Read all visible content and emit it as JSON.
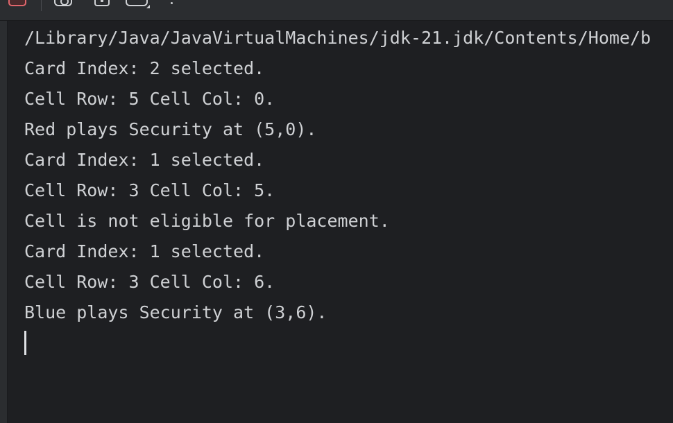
{
  "toolbar": {
    "icons": [
      "stop-icon",
      "screenshot-icon",
      "pin-icon",
      "restore-layout-icon",
      "more-icon"
    ],
    "colors": {
      "stop": "#e0666c",
      "icon": "#cfd1d4"
    }
  },
  "console": {
    "lines": [
      "/Library/Java/JavaVirtualMachines/jdk-21.jdk/Contents/Home/b",
      "Card Index: 2 selected.",
      "Cell Row: 5 Cell Col: 0.",
      "Red plays Security at (5,0).",
      "Card Index: 1 selected.",
      "Cell Row: 3 Cell Col: 5.",
      "Cell is not eligible for placement.",
      "Card Index: 1 selected.",
      "Cell Row: 3 Cell Col: 6.",
      "Blue plays Security at (3,6)."
    ],
    "colors": {
      "background": "#1e1f22",
      "text": "#cfd1d4"
    }
  }
}
